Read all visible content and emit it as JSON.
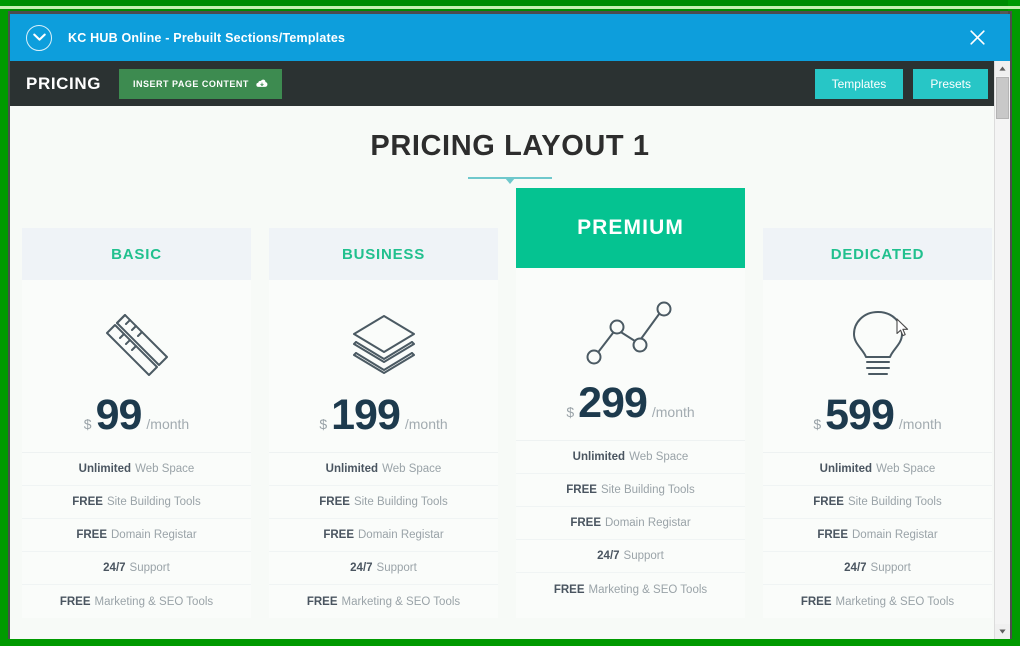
{
  "window": {
    "title": "KC HUB Online - Prebuilt Sections/Templates",
    "collapse_icon": "chevron-down-icon",
    "close_icon": "close-icon"
  },
  "toolbar": {
    "label": "PRICING",
    "insert_button": "INSERT PAGE CONTENT",
    "insert_button_icon": "cloud-download-icon",
    "templates_button": "Templates",
    "presets_button": "Presets",
    "accent_green": "#3d8b50",
    "accent_teal": "#27c6c6",
    "bar_color": "#2b3232",
    "titlebar_color": "#0d9edc"
  },
  "content": {
    "heading": "PRICING LAYOUT 1",
    "divider_color": "#6fc8cc",
    "background": "#f7faf7"
  },
  "scrollbar": {
    "up_arrow": "▲",
    "down_arrow": "▼"
  },
  "rail_marks": "-  r  r  a      o  o  -  B  o",
  "plans": [
    {
      "name": "BASIC",
      "icon": "pencil-ruler-icon",
      "currency": "$",
      "price": "99",
      "period": "/month",
      "featured": false,
      "header_bg": "#eff3f7",
      "name_color": "#21c08e",
      "features": [
        {
          "strong": "Unlimited",
          "rest": "Web Space"
        },
        {
          "strong": "FREE",
          "rest": "Site Building Tools"
        },
        {
          "strong": "FREE",
          "rest": "Domain Registar"
        },
        {
          "strong": "24/7",
          "rest": "Support"
        },
        {
          "strong": "FREE",
          "rest": "Marketing & SEO Tools"
        }
      ]
    },
    {
      "name": "BUSINESS",
      "icon": "layers-stack-icon",
      "currency": "$",
      "price": "199",
      "period": "/month",
      "featured": false,
      "header_bg": "#eff3f7",
      "name_color": "#21c08e",
      "features": [
        {
          "strong": "Unlimited",
          "rest": "Web Space"
        },
        {
          "strong": "FREE",
          "rest": "Site Building Tools"
        },
        {
          "strong": "FREE",
          "rest": "Domain Registar"
        },
        {
          "strong": "24/7",
          "rest": "Support"
        },
        {
          "strong": "FREE",
          "rest": "Marketing & SEO Tools"
        }
      ]
    },
    {
      "name": "PREMIUM",
      "icon": "line-chart-nodes-icon",
      "currency": "$",
      "price": "299",
      "period": "/month",
      "featured": true,
      "header_bg": "#05c391",
      "name_color": "#ffffff",
      "features": [
        {
          "strong": "Unlimited",
          "rest": "Web Space"
        },
        {
          "strong": "FREE",
          "rest": "Site Building Tools"
        },
        {
          "strong": "FREE",
          "rest": "Domain Registar"
        },
        {
          "strong": "24/7",
          "rest": "Support"
        },
        {
          "strong": "FREE",
          "rest": "Marketing & SEO Tools"
        }
      ]
    },
    {
      "name": "DEDICATED",
      "icon": "lightbulb-icon",
      "currency": "$",
      "price": "599",
      "period": "/month",
      "featured": false,
      "header_bg": "#eff3f7",
      "name_color": "#21c08e",
      "features": [
        {
          "strong": "Unlimited",
          "rest": "Web Space"
        },
        {
          "strong": "FREE",
          "rest": "Site Building Tools"
        },
        {
          "strong": "FREE",
          "rest": "Domain Registar"
        },
        {
          "strong": "24/7",
          "rest": "Support"
        },
        {
          "strong": "FREE",
          "rest": "Marketing & SEO Tools"
        }
      ]
    }
  ]
}
